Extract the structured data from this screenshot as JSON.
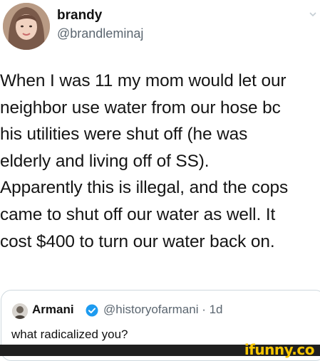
{
  "tweet": {
    "author_name": "brandy",
    "author_handle": "@brandleminaj",
    "text": "When I was 11 my mom would let our\nneighbor use water from our hose bc\nhis utilities were shut off (he was\nelderly and living off of SS).\nApparently this is illegal, and the cops\ncame to shut off our water as well. It\ncost $400 to turn our water back on.",
    "menu_icon": "chevron-down-icon"
  },
  "quote": {
    "author_name": "Armani",
    "author_handle": "@historyofarmani · 1d",
    "verified_icon": "verified-badge-icon",
    "text": "what radicalized you?"
  },
  "watermark": {
    "text": "ifunny.co",
    "color": "#f5c400"
  }
}
